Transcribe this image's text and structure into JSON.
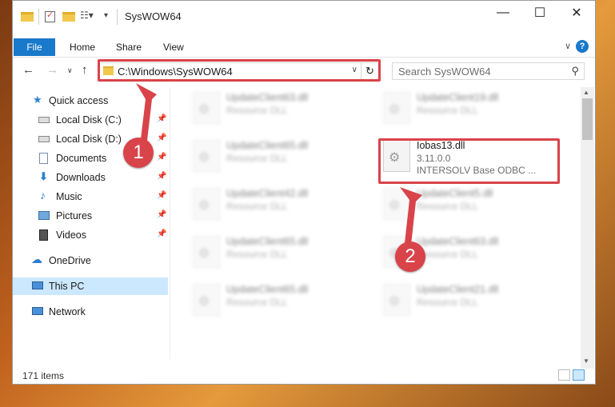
{
  "window": {
    "title": "SysWOW64",
    "controls": {
      "minimize": "—",
      "maximize": "☐",
      "close": "✕"
    }
  },
  "ribbon": {
    "tabs": [
      "File",
      "Home",
      "Share",
      "View"
    ],
    "help": "?"
  },
  "address": {
    "path": "C:\\Windows\\SysWOW64",
    "search_placeholder": "Search SysWOW64"
  },
  "sidebar": {
    "items": [
      {
        "label": "Quick access",
        "icon": "star-icon",
        "pinned": false
      },
      {
        "label": "Local Disk (C:)",
        "icon": "drive-icon",
        "pinned": true
      },
      {
        "label": "Local Disk (D:)",
        "icon": "drive-icon",
        "pinned": true
      },
      {
        "label": "Documents",
        "icon": "documents-icon",
        "pinned": true
      },
      {
        "label": "Downloads",
        "icon": "download-icon",
        "pinned": true
      },
      {
        "label": "Music",
        "icon": "music-icon",
        "pinned": true
      },
      {
        "label": "Pictures",
        "icon": "pictures-icon",
        "pinned": true
      },
      {
        "label": "Videos",
        "icon": "videos-icon",
        "pinned": true
      },
      {
        "label": "OneDrive",
        "icon": "cloud-icon",
        "pinned": false
      },
      {
        "label": "This PC",
        "icon": "computer-icon",
        "pinned": false
      },
      {
        "label": "Network",
        "icon": "network-icon",
        "pinned": false
      }
    ]
  },
  "files": {
    "left": [
      {
        "name": "UpdateClient63.dll",
        "desc": "Resource DLL"
      },
      {
        "name": "UpdateClient65.dll",
        "desc": "Resource DLL"
      },
      {
        "name": "UpdateClient42.dll",
        "desc": "Resource DLL"
      },
      {
        "name": "UpdateClient65.dll",
        "desc": "Resource DLL"
      },
      {
        "name": "UpdateClient65.dll",
        "desc": "Resource DLL"
      }
    ],
    "right": [
      {
        "name": "UpdateClient19.dll",
        "desc": "Resource DLL"
      },
      {
        "name": "UpdateClient5.dll",
        "desc": "Resource DLL"
      },
      {
        "name": "UpdateClient63.dll",
        "desc": "Resource DLL"
      },
      {
        "name": "UpdateClient21.dll",
        "desc": "Resource DLL"
      }
    ],
    "focus": {
      "name": "Iobas13.dll",
      "version": "3.11.0.0",
      "desc": "INTERSOLV Base ODBC ..."
    }
  },
  "status": {
    "count": "171 items"
  },
  "annotations": {
    "step1": "1",
    "step2": "2",
    "color": "#d9434a"
  }
}
